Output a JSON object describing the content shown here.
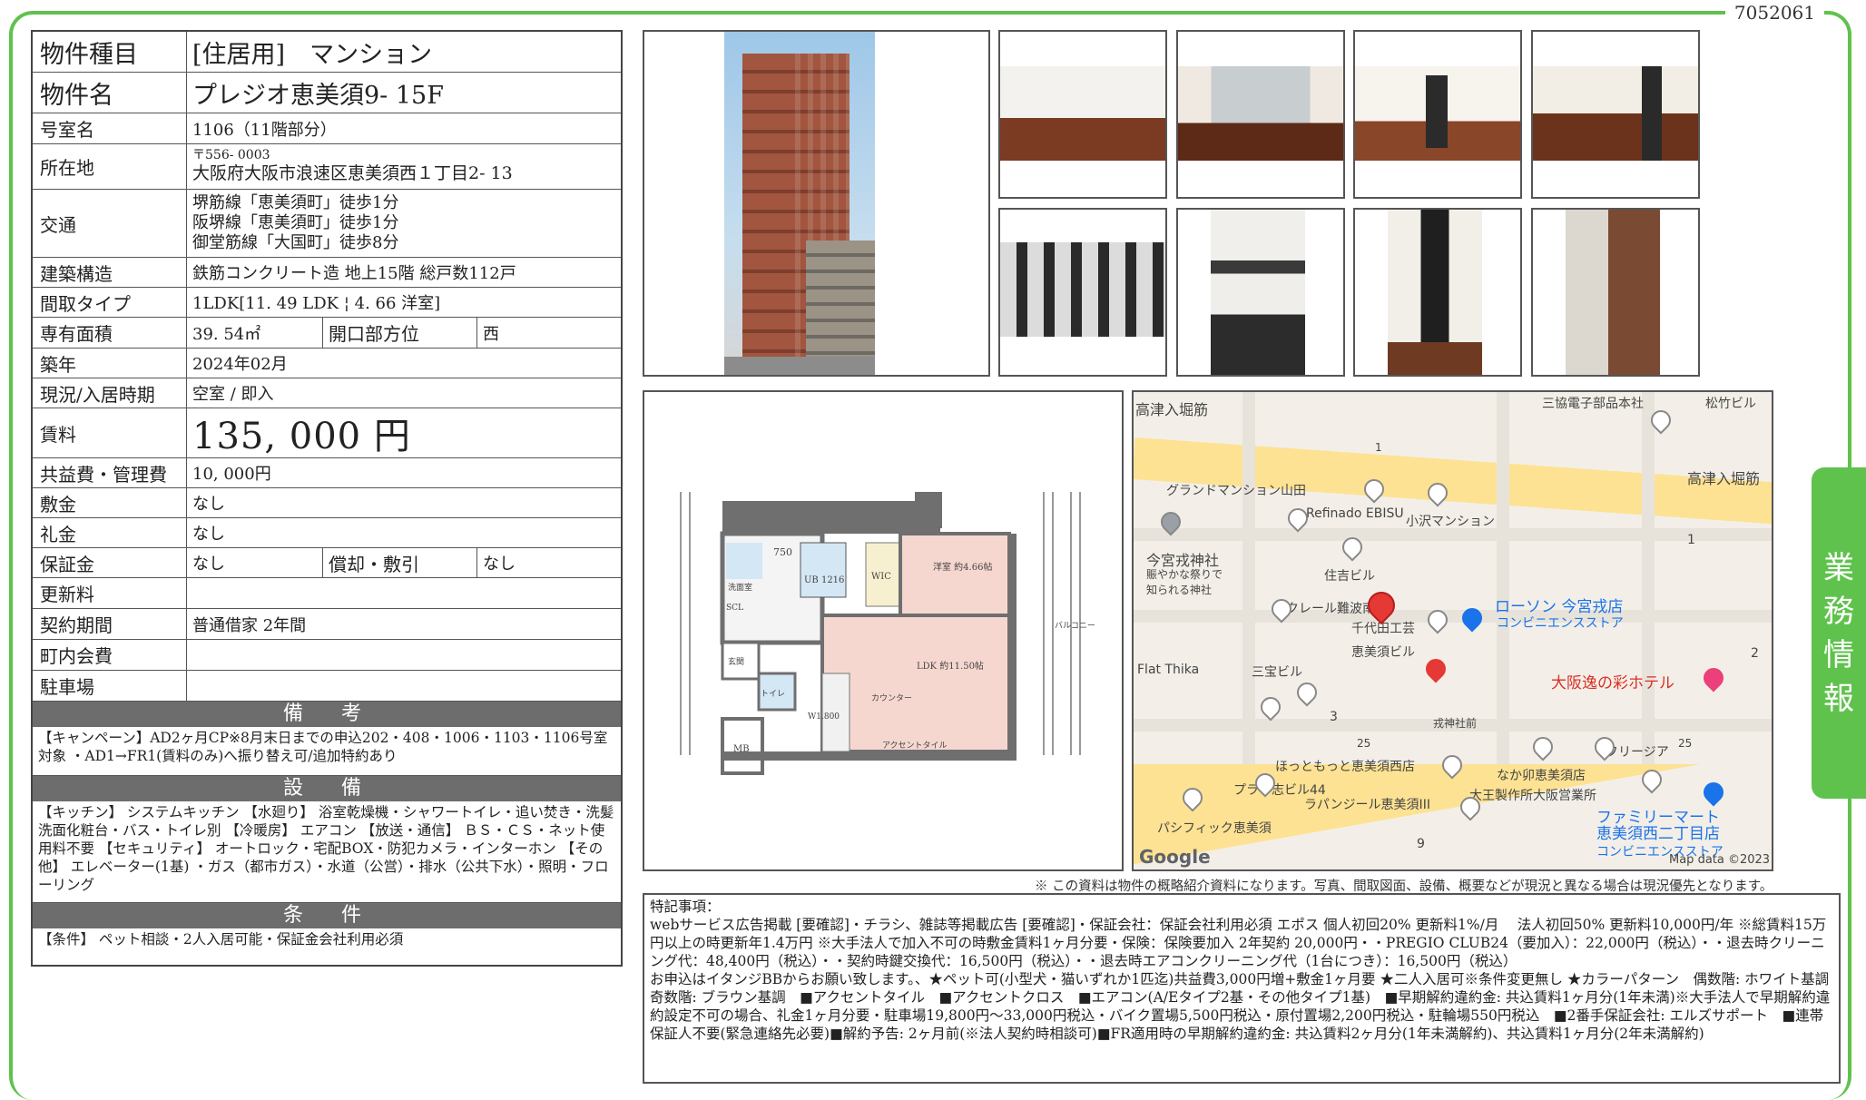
{
  "doc_id": "7052061",
  "spec": {
    "type": {
      "label": "物件種目",
      "value": "[住居用]　マンション"
    },
    "name": {
      "label": "物件名",
      "value": "プレジオ恵美須9- 15F"
    },
    "room": {
      "label": "号室名",
      "value": "1106（11階部分）"
    },
    "address": {
      "label": "所在地",
      "zip": "〒556- 0003",
      "value": "大阪府大阪市浪速区恵美須西１丁目2- 13"
    },
    "access": {
      "label": "交通",
      "lines": [
        "堺筋線「恵美須町」徒歩1分",
        "阪堺線「恵美須町」徒歩1分",
        "御堂筋線「大国町」徒歩8分"
      ]
    },
    "structure": {
      "label": "建築構造",
      "value": "鉄筋コンクリート造  地上15階  総戸数112戸"
    },
    "layout": {
      "label": "間取タイプ",
      "value": "1LDK[11. 49  LDK ¦  4. 66  洋室]"
    },
    "area": {
      "label": "専有面積",
      "value": "39. 54㎡",
      "sub_label": "開口部方位",
      "sub_value": "西"
    },
    "built": {
      "label": "築年",
      "value": "2024年02月"
    },
    "status": {
      "label": "現況/入居時期",
      "value": "空室  /  即入"
    },
    "rent": {
      "label": "賃料",
      "value": "135, 000  円"
    },
    "fee": {
      "label": "共益費・管理費",
      "value": "10, 000円"
    },
    "deposit": {
      "label": "敷金",
      "value": "なし"
    },
    "key_money": {
      "label": "礼金",
      "value": "なし"
    },
    "guarantee": {
      "label": "保証金",
      "value": "なし",
      "sub_label": "償却・敷引",
      "sub_value": "なし"
    },
    "renewal": {
      "label": "更新料",
      "value": ""
    },
    "contract": {
      "label": "契約期間",
      "value": "普通借家  2年間"
    },
    "community": {
      "label": "町内会費",
      "value": ""
    },
    "parking": {
      "label": "駐車場",
      "value": ""
    }
  },
  "remarks": {
    "title": "備　考",
    "text": "【キャンペーン】AD2ヶ月CP※8月末日までの申込202・408・1006・1103・1106号室対象  ・AD1→FR1(賃料のみ)へ振り替え可/追加特約あり"
  },
  "equipment": {
    "title": "設　備",
    "text": "【キッチン】  システムキッチン  【水廻り】  浴室乾燥機・シャワートイレ・追い焚き・洗髪洗面化粧台・バス・トイレ別  【冷暖房】  エアコン  【放送・通信】  ＢＳ・ＣＳ・ネット使用料不要  【セキュリティ】  オートロック・宅配BOX・防犯カメラ・インターホン  【その他】  エレベーター(1基)  ・ガス（都市ガス）・水道（公営）・排水（公共下水）・照明・フローリング"
  },
  "conditions": {
    "title": "条　件",
    "text": "【条件】  ペット相談・2人入居可能・保証金会社利用必須"
  },
  "floorplan": {
    "labels": [
      "750",
      "洗面室",
      "UB\n1216",
      "WIC",
      "洋室\n約4.66帖",
      "SCL",
      "玄関",
      "トイレ",
      "LDK\n約11.50帖",
      "カウンター",
      "W1.800",
      "アクセントタイル",
      "MB",
      "バルコニー"
    ]
  },
  "map": {
    "labels": [
      "高津入堀筋",
      "三協電子部品本社",
      "松竹ビル",
      "高津入堀筋",
      "グランドマンション山田",
      "Refinado EBISU",
      "小沢マンション",
      "今宮戎神社",
      "賑やかな祭りで\n知られる神社",
      "住吉ビル",
      "クレール難波南",
      "千代田工芸",
      "恵美須ビル",
      "ローソン 今宮戎店",
      "コンビニエンスストア",
      "Flat Thika",
      "三宝ビル",
      "大阪逸の彩ホテル",
      "戎神社前",
      "フリージア",
      "ほっともっと恵美須西店",
      "なか卯恵美須店",
      "プラザ志ビル44",
      "ラパンジール恵美須III",
      "大王製作所大阪営業所",
      "パシフィック恵美須",
      "ファミリーマート\n恵美須西二丁目店",
      "コンビニエンスストア",
      "Google",
      "Map data ©2023",
      "1",
      "2",
      "3",
      "9",
      "25",
      "25",
      "1"
    ]
  },
  "disclaimer": "※  この資料は物件の概略紹介資料になります。写真、間取図面、設備、概要などが現況と異なる場合は現況優先となります。",
  "notes": {
    "title": "特記事項：",
    "p1": "webサービス広告掲載 [要確認]・チラシ、雑誌等掲載広告 [要確認]・保証会社：保証会社利用必須  エポス  個人初回20%  更新料1%/月　 法人初回50%  更新料10,000円/年  ※総賃料15万円以上の時更新年1.4万円  ※大手法人で加入不可の時敷金賃料1ヶ月分要・保険：保険要加入  2年契約  20,000円・・PREGIO CLUB24（要加入）：22,000円（税込）・・退去時クリーニング代：48,400円（税込）・・契約時鍵交換代：16,500円（税込）・・退去時エアコンクリーニング代（1台につき）：16,500円（税込）",
    "p2": "お申込はイタンジBBからお願い致します。、★ペット可(小型犬・猫いずれか1匹迄)共益費3,000円増+敷金1ヶ月要  ★二人入居可※条件変更無し  ★カラーパターン　偶数階: ホワイト基調　奇数階: ブラウン基調　■アクセントタイル　■アクセントクロス　■エアコン(A/Eタイプ2基・その他タイプ1基)　■早期解約違約金: 共込賃料1ヶ月分(1年未満)※大手法人で早期解約違約設定不可の場合、礼金1ヶ月分要・駐車場19,800円～33,000円税込・バイク置場5,500円税込・原付置場2,200円税込・駐輪場550円税込　■2番手保証会社: エルズサポート　■連帯保証人不要(緊急連絡先必要)■解約予告: 2ヶ月前(※法人契約時相談可)■FR適用時の早期解約違約金: 共込賃料2ヶ月分(1年未満解約)、共込賃料1ヶ月分(2年未満解約)"
  },
  "side_tab": [
    "業",
    "務",
    "情",
    "報"
  ],
  "colors": {
    "frame": "#5fc24d",
    "section_head": "#6d6d6d",
    "map_road": "#fde293"
  }
}
